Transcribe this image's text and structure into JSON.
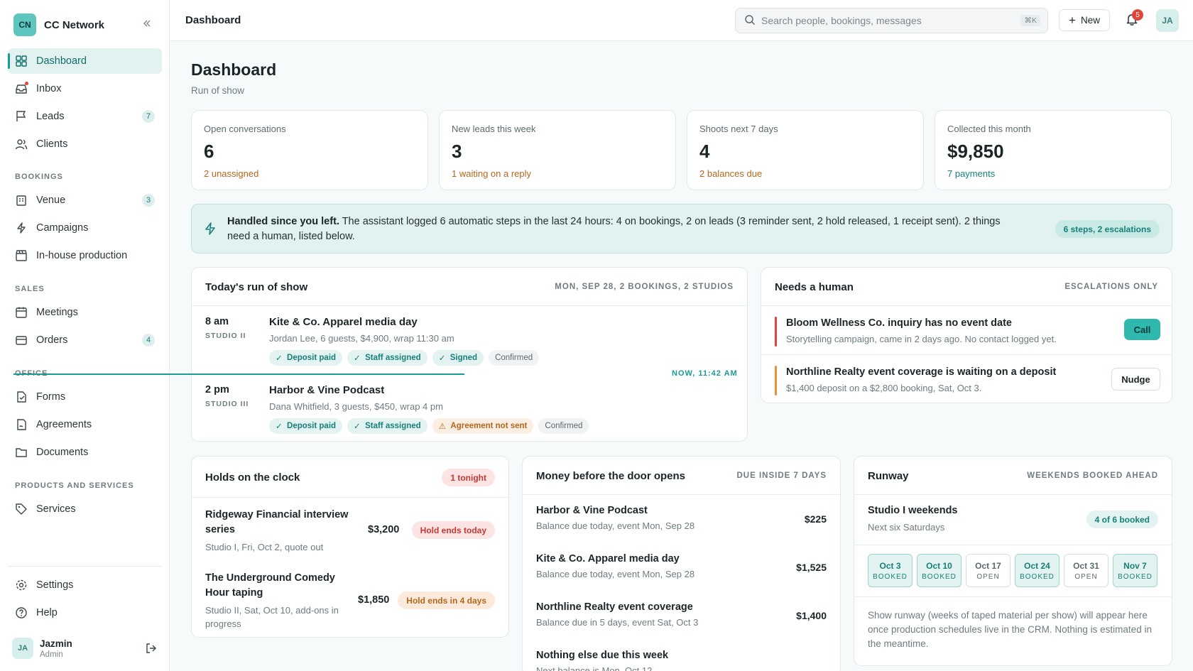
{
  "brand": {
    "initials": "CN",
    "name": "CC Network"
  },
  "nav": {
    "main": [
      {
        "label": "Dashboard",
        "icon": "grid-icon",
        "active": true
      },
      {
        "label": "Inbox",
        "icon": "inbox-icon",
        "dot": true
      },
      {
        "label": "Leads",
        "icon": "flag-icon",
        "badge": "7"
      },
      {
        "label": "Clients",
        "icon": "users-icon"
      }
    ],
    "sections": {
      "bookings": "BOOKINGS",
      "sales": "SALES",
      "office": "OFFICE",
      "products": "PRODUCTS AND SERVICES"
    },
    "bookings": [
      {
        "label": "Venue",
        "badge": "3"
      },
      {
        "label": "Campaigns"
      },
      {
        "label": "In-house production"
      }
    ],
    "sales": [
      {
        "label": "Meetings"
      },
      {
        "label": "Orders",
        "badge": "4"
      }
    ],
    "office": [
      {
        "label": "Forms"
      },
      {
        "label": "Agreements"
      },
      {
        "label": "Documents"
      }
    ],
    "products": [
      {
        "label": "Services"
      }
    ],
    "footer": [
      {
        "label": "Settings"
      },
      {
        "label": "Help"
      }
    ]
  },
  "user": {
    "initials": "JA",
    "name": "Jazmin",
    "role": "Admin"
  },
  "topbar": {
    "title": "Dashboard",
    "search_placeholder": "Search people, bookings, messages",
    "shortcut": "⌘K",
    "new_label": "New",
    "notifications": "5",
    "avatar": "JA"
  },
  "page": {
    "title": "Dashboard",
    "subtitle": "Run of show"
  },
  "kpis": [
    {
      "label": "Open conversations",
      "value": "6",
      "sub": "2 unassigned",
      "sub_color": "#b4661c"
    },
    {
      "label": "New leads this week",
      "value": "3",
      "sub": "1 waiting on a reply",
      "sub_color": "#b4661c"
    },
    {
      "label": "Shoots next 7 days",
      "value": "4",
      "sub": "2 balances due",
      "sub_color": "#b4661c"
    },
    {
      "label": "Collected this month",
      "value": "$9,850",
      "sub": "7 payments",
      "sub_color": "#17807a"
    }
  ],
  "banner": {
    "lead": "Handled since you left.",
    "text": " The assistant logged 6 automatic steps in the last 24 hours: 4 on bookings, 2 on leads (3 reminder sent, 2 hold released, 1 receipt sent). 2 things need a human, listed below.",
    "pill": "6 steps, 2 escalations"
  },
  "run_of_show": {
    "title": "Today's run of show",
    "meta": "MON, SEP 28, 2 BOOKINGS, 2 STUDIOS",
    "now_label": "NOW, 11:42 AM",
    "rows": [
      {
        "time": "8 am",
        "studio": "STUDIO II",
        "name": "Kite & Co. Apparel media day",
        "detail": "Jordan Lee, 6 guests, $4,900, wrap 11:30 am",
        "tags": [
          {
            "label": "Deposit paid",
            "kind": "ok"
          },
          {
            "label": "Staff assigned",
            "kind": "ok"
          },
          {
            "label": "Signed",
            "kind": "ok"
          },
          {
            "label": "Confirmed",
            "kind": "plain"
          }
        ]
      },
      {
        "time": "2 pm",
        "studio": "STUDIO III",
        "name": "Harbor & Vine Podcast",
        "detail": "Dana Whitfield, 3 guests, $450, wrap 4 pm",
        "tags": [
          {
            "label": "Deposit paid",
            "kind": "ok"
          },
          {
            "label": "Staff assigned",
            "kind": "ok"
          },
          {
            "label": "Agreement not sent",
            "kind": "warn"
          },
          {
            "label": "Confirmed",
            "kind": "plain"
          }
        ]
      }
    ]
  },
  "needs_human": {
    "title": "Needs a human",
    "meta": "ESCALATIONS ONLY",
    "items": [
      {
        "title": "Bloom Wellness Co. inquiry has no event date",
        "sub": "Storytelling campaign, came in 2 days ago. No contact logged yet.",
        "action": "Call",
        "color": "#e0453c"
      },
      {
        "title": "Northline Realty event coverage is waiting on a deposit",
        "sub": "$1,400 deposit on a $2,800 booking, Sat, Oct 3.",
        "action": "Nudge",
        "color": "#e8913a"
      }
    ]
  },
  "holds": {
    "title": "Holds on the clock",
    "pill": "1 tonight",
    "items": [
      {
        "name": "Ridgeway Financial interview series",
        "sub": "Studio I, Fri, Oct 2, quote out",
        "amount": "$3,200",
        "status": "Hold ends today"
      },
      {
        "name": "The Underground Comedy Hour taping",
        "sub": "Studio II, Sat, Oct 10, add-ons in progress",
        "amount": "$1,850",
        "status": "Hold ends in 4 days"
      }
    ]
  },
  "money": {
    "title": "Money before the door opens",
    "meta": "DUE INSIDE 7 DAYS",
    "items": [
      {
        "name": "Harbor & Vine Podcast",
        "sub": "Balance due today, event Mon, Sep 28",
        "amount": "$225"
      },
      {
        "name": "Kite & Co. Apparel media day",
        "sub": "Balance due today, event Mon, Sep 28",
        "amount": "$1,525"
      },
      {
        "name": "Northline Realty event coverage",
        "sub": "Balance due in 5 days, event Sat, Oct 3",
        "amount": "$1,400"
      },
      {
        "name": "Nothing else due this week",
        "sub": "Next balance is Mon, Oct 12",
        "amount": ""
      }
    ]
  },
  "runway": {
    "title": "Runway",
    "meta": "WEEKENDS BOOKED AHEAD",
    "studio": "Studio I weekends",
    "studio_sub": "Next six Saturdays",
    "pill": "4 of 6 booked",
    "weeks": [
      {
        "date": "Oct 3",
        "state": "BOOKED"
      },
      {
        "date": "Oct 10",
        "state": "BOOKED"
      },
      {
        "date": "Oct 17",
        "state": "OPEN"
      },
      {
        "date": "Oct 24",
        "state": "BOOKED"
      },
      {
        "date": "Oct 31",
        "state": "OPEN"
      },
      {
        "date": "Nov 7",
        "state": "BOOKED"
      }
    ],
    "note": "Show runway (weeks of taped material per show) will appear here once production schedules live in the CRM. Nothing is estimated in the meantime."
  }
}
